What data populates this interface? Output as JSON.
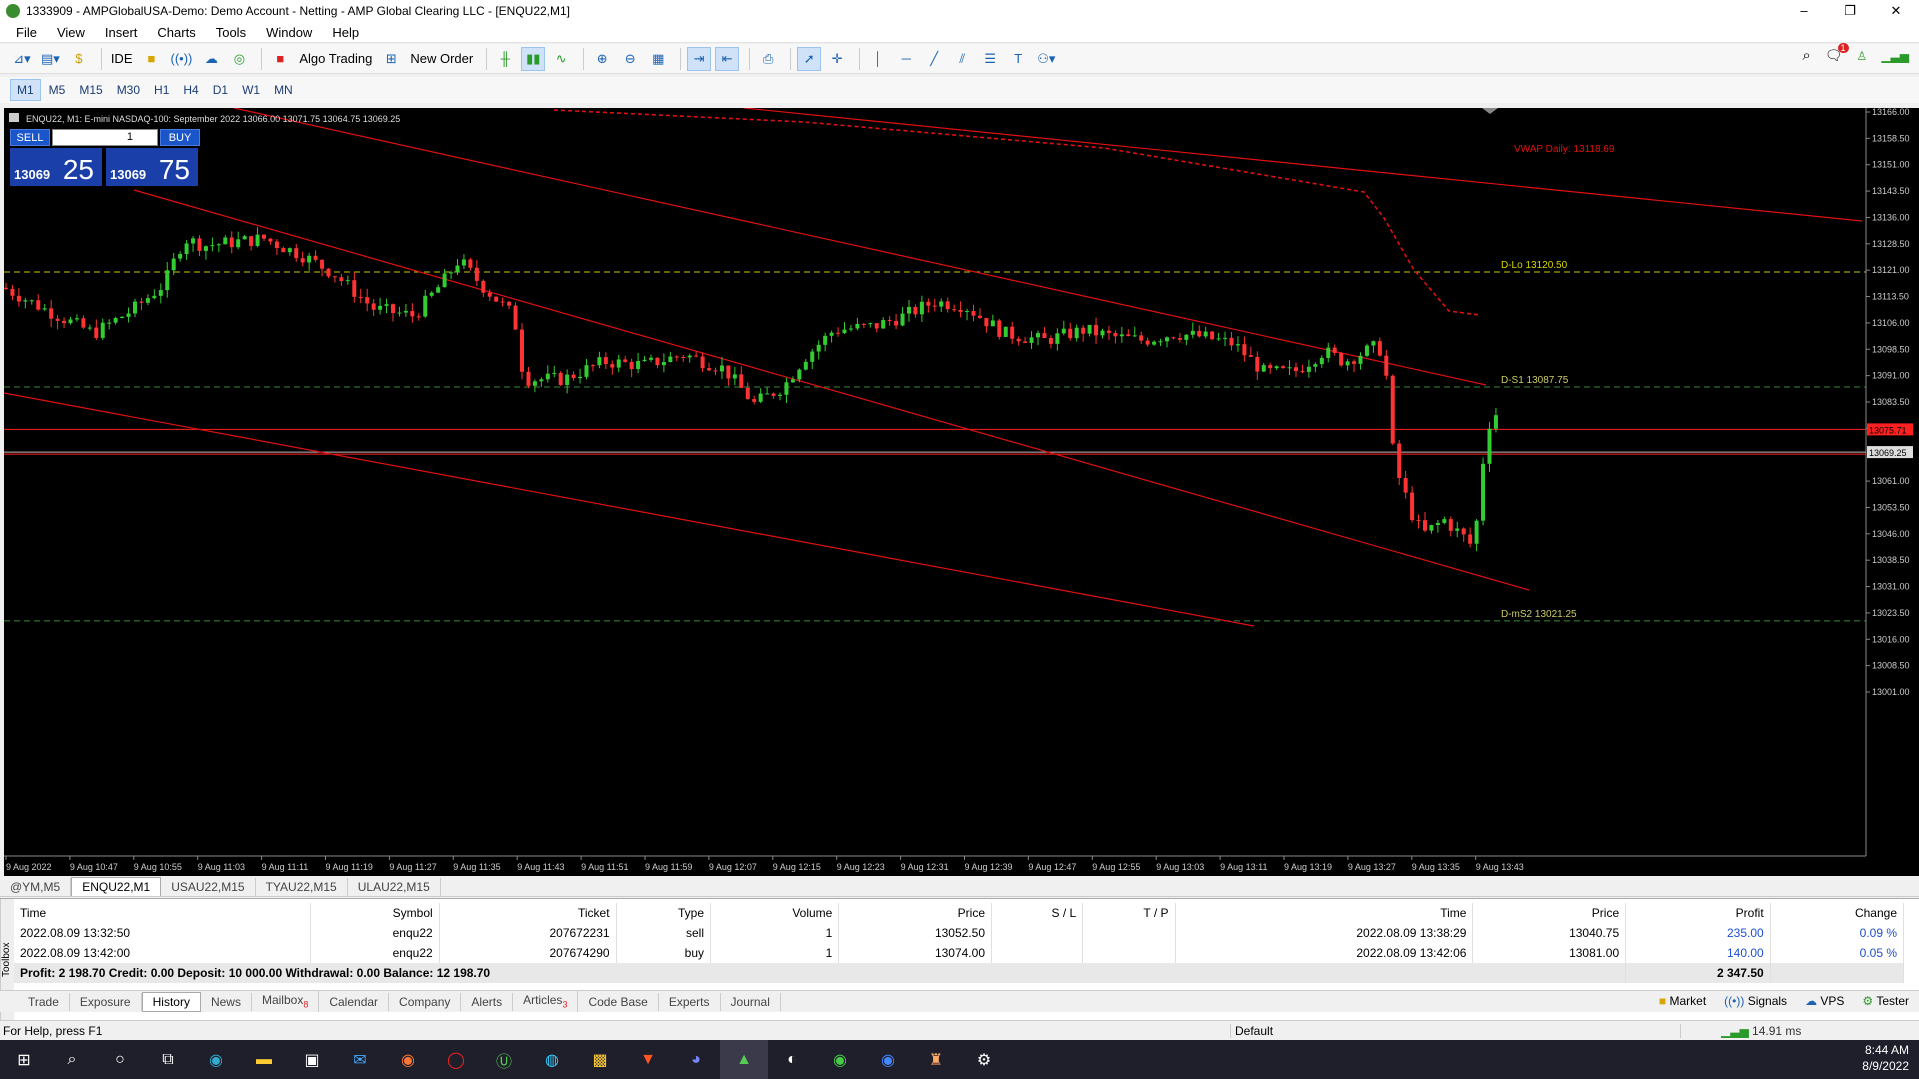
{
  "window": {
    "title": "1333909 - AMPGlobalUSA-Demo: Demo Account - Netting - AMP Global Clearing LLC - [ENQU22,M1]",
    "controls": [
      "–",
      "❐",
      "✕"
    ]
  },
  "menu": [
    "File",
    "View",
    "Insert",
    "Charts",
    "Tools",
    "Window",
    "Help"
  ],
  "toolbar": {
    "ide_label": "IDE",
    "algo_label": "Algo Trading",
    "new_order_label": "New Order",
    "notification_count": "1"
  },
  "timeframes": [
    "M1",
    "M5",
    "M15",
    "M30",
    "H1",
    "H4",
    "D1",
    "W1",
    "MN"
  ],
  "chart": {
    "header": "ENQU22, M1:  E-mini NASDAQ-100: September 2022   13066.00 13071.75 13064.75 13069.25",
    "trade_panel": {
      "sell_label": "SELL",
      "buy_label": "BUY",
      "lot": "1",
      "sell_small": "13069",
      "sell_big": "25",
      "buy_small": "13069",
      "buy_big": "75"
    },
    "price_ticks": [
      "13166.00",
      "13158.50",
      "13151.00",
      "13143.50",
      "13136.00",
      "13128.50",
      "13121.00",
      "13113.50",
      "13106.00",
      "13098.50",
      "13091.00",
      "13083.50",
      "13076.00",
      "13069.25",
      "13061.00",
      "13053.50",
      "13046.00",
      "13038.50",
      "13031.00",
      "13023.50",
      "13016.00",
      "13008.50",
      "13001.00"
    ],
    "time_ticks": [
      "9 Aug 2022",
      "9 Aug 10:47",
      "9 Aug 10:55",
      "9 Aug 11:03",
      "9 Aug 11:11",
      "9 Aug 11:19",
      "9 Aug 11:27",
      "9 Aug 11:35",
      "9 Aug 11:43",
      "9 Aug 11:51",
      "9 Aug 11:59",
      "9 Aug 12:07",
      "9 Aug 12:15",
      "9 Aug 12:23",
      "9 Aug 12:31",
      "9 Aug 12:39",
      "9 Aug 12:47",
      "9 Aug 12:55",
      "9 Aug 13:03",
      "9 Aug 13:11",
      "9 Aug 13:19",
      "9 Aug 13:27",
      "9 Aug 13:35",
      "9 Aug 13:43"
    ],
    "vwap_label": "VWAP Daily: 13118.69",
    "levels": [
      {
        "label": "D-Lo 13120.50",
        "price": 13120.5,
        "color": "#c8c800"
      },
      {
        "label": "D-S1 13087.75",
        "price": 13087.75,
        "color": "#3a8a3a"
      },
      {
        "label": "D-mS2 13021.25",
        "price": 13021.25,
        "color": "#3a8a3a"
      }
    ],
    "ask_line": {
      "label": "13075.71",
      "price": 13075.71
    },
    "bid_line": {
      "label": "13069.25",
      "price": 13069.25
    },
    "colors": {
      "up": "#33cc33",
      "down": "#ff3333",
      "trend": "#e01010",
      "bg": "#000000"
    }
  },
  "chart_tabs": [
    "@YM,M5",
    "ENQU22,M1",
    "USAU22,M15",
    "TYAU22,M15",
    "ULAU22,M15"
  ],
  "history": {
    "columns": [
      "Time",
      "Symbol",
      "Ticket",
      "Type",
      "Volume",
      "Price",
      "S / L",
      "T / P",
      "Time",
      "Price",
      "Profit",
      "Change"
    ],
    "rows": [
      [
        "2022.08.09 13:32:50",
        "enqu22",
        "207672231",
        "sell",
        "1",
        "13052.50",
        "",
        "",
        "2022.08.09 13:38:29",
        "13040.75",
        "235.00",
        "0.09 %"
      ],
      [
        "2022.08.09 13:42:00",
        "enqu22",
        "207674290",
        "buy",
        "1",
        "13074.00",
        "",
        "",
        "2022.08.09 13:42:06",
        "13081.00",
        "140.00",
        "0.05 %"
      ]
    ],
    "summary": "Profit: 2 198.70  Credit: 0.00  Deposit: 10 000.00  Withdrawal: 0.00  Balance: 12 198.70",
    "summary_total": "2 347.50"
  },
  "toolbox_label": "Toolbox",
  "terminal_tabs": [
    {
      "label": "Trade",
      "badge": ""
    },
    {
      "label": "Exposure",
      "badge": ""
    },
    {
      "label": "History",
      "badge": ""
    },
    {
      "label": "News",
      "badge": ""
    },
    {
      "label": "Mailbox",
      "badge": "8"
    },
    {
      "label": "Calendar",
      "badge": ""
    },
    {
      "label": "Company",
      "badge": ""
    },
    {
      "label": "Alerts",
      "badge": ""
    },
    {
      "label": "Articles",
      "badge": "3"
    },
    {
      "label": "Code Base",
      "badge": ""
    },
    {
      "label": "Experts",
      "badge": ""
    },
    {
      "label": "Journal",
      "badge": ""
    }
  ],
  "terminal_right": [
    "Market",
    "Signals",
    "VPS",
    "Tester"
  ],
  "status": {
    "help": "For Help, press F1",
    "profile": "Default",
    "ping": "14.91 ms"
  },
  "clock": {
    "time": "8:44 AM",
    "date": "8/9/2022"
  }
}
